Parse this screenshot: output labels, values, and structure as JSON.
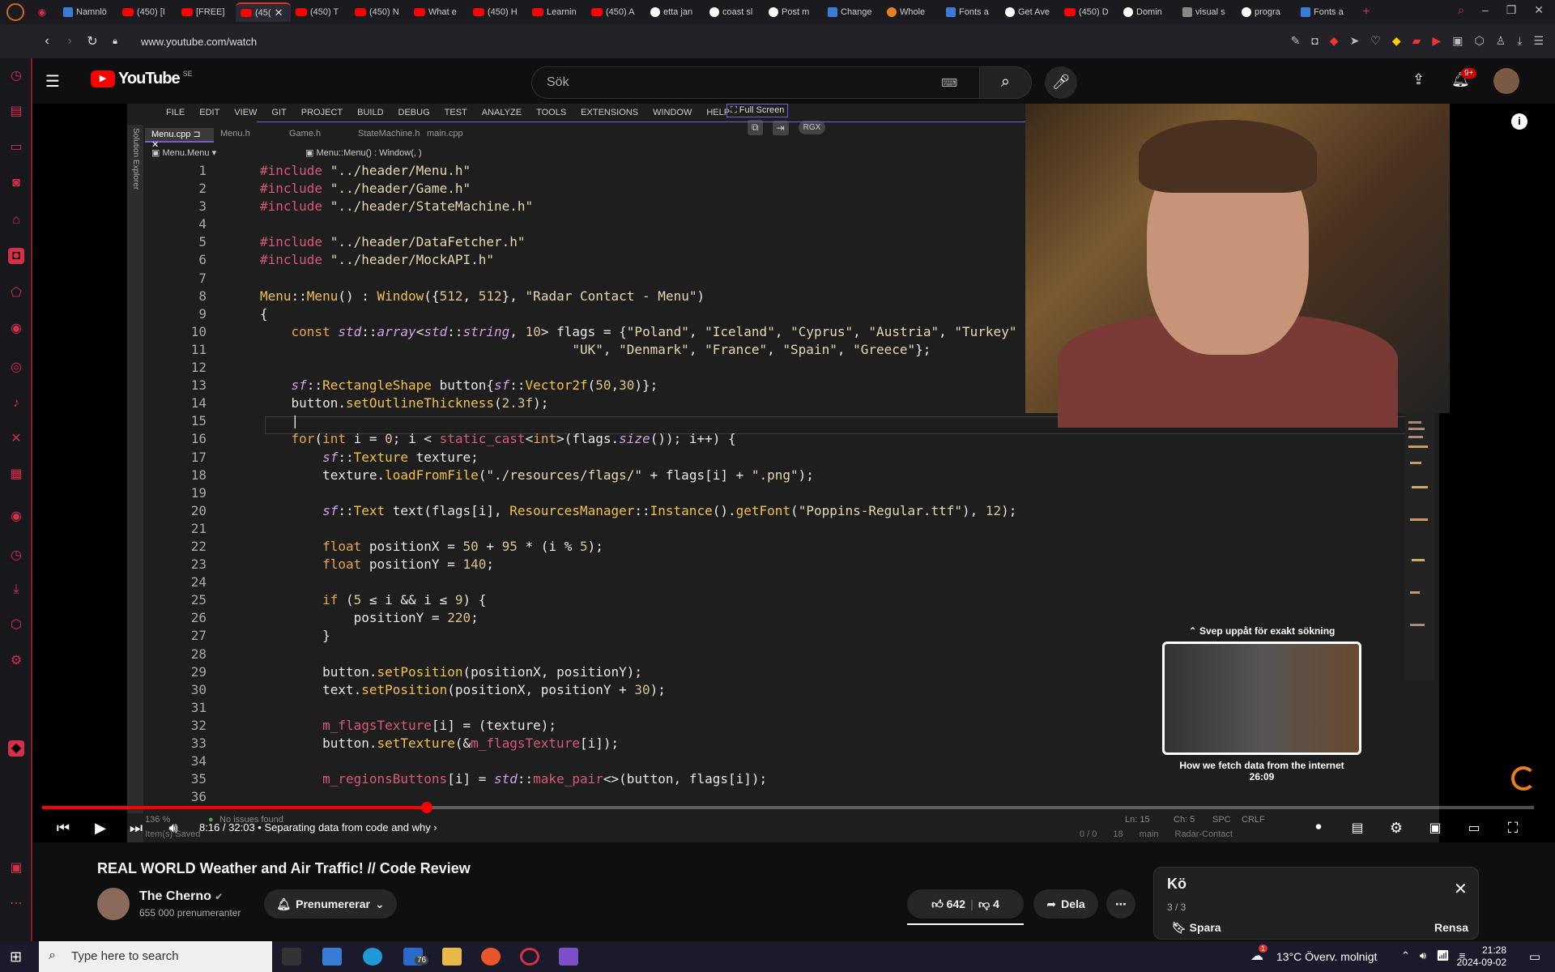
{
  "browser": {
    "tabs": [
      {
        "label": "Namnlö",
        "icon": "docs-icon"
      },
      {
        "label": "(450) [I",
        "icon": "youtube-icon"
      },
      {
        "label": "[FREE]",
        "icon": "youtube-icon"
      },
      {
        "label": "(45(",
        "icon": "youtube-icon",
        "active": true
      },
      {
        "label": "(450) T",
        "icon": "youtube-icon"
      },
      {
        "label": "(450) N",
        "icon": "youtube-icon"
      },
      {
        "label": "What e",
        "icon": "youtube-icon"
      },
      {
        "label": "(450) H",
        "icon": "youtube-icon"
      },
      {
        "label": "Learnin",
        "icon": "youtube-icon"
      },
      {
        "label": "(450) A",
        "icon": "youtube-icon"
      },
      {
        "label": "etta jan",
        "icon": "google-icon"
      },
      {
        "label": "coast sl",
        "icon": "google-icon"
      },
      {
        "label": "Post m",
        "icon": "google-icon"
      },
      {
        "label": "Change",
        "icon": "microsoft-icon"
      },
      {
        "label": "Whole",
        "icon": "fruit-icon"
      },
      {
        "label": "Fonts a",
        "icon": "microsoft-icon"
      },
      {
        "label": "Get Ave",
        "icon": "google-icon"
      },
      {
        "label": "(450) D",
        "icon": "youtube-icon"
      },
      {
        "label": "Domin",
        "icon": "google-icon"
      },
      {
        "label": "visual s",
        "icon": "tool-icon"
      },
      {
        "label": "progra",
        "icon": "google-icon"
      },
      {
        "label": "Fonts a",
        "icon": "microsoft-icon"
      }
    ],
    "url": "www.youtube.com/watch"
  },
  "youtube": {
    "logo": "YouTube",
    "region": "SE",
    "search_placeholder": "Sök",
    "notifications": "9+"
  },
  "ide": {
    "menu": [
      "FILE",
      "EDIT",
      "VIEW",
      "GIT",
      "PROJECT",
      "BUILD",
      "DEBUG",
      "TEST",
      "ANALYZE",
      "TOOLS",
      "EXTENSIONS",
      "WINDOW",
      "HELP"
    ],
    "fullscreen": "Full Screen",
    "rgx": "RGX",
    "doc_tabs": [
      "Menu.cpp",
      "Menu.h",
      "Game.h",
      "StateMachine.h",
      "main.cpp"
    ],
    "solution_explorer": "Solution Explorer",
    "nav_left": "Menu.Menu",
    "nav_right": "Menu::Menu() : Window(, )",
    "status": {
      "zoom": "136 %",
      "issues": "No issues found",
      "ln": "Ln: 15",
      "ch": "Ch: 5",
      "spc": "SPC",
      "crlf": "CRLF",
      "saved": "Item(s) Saved",
      "errors": "0 / 0",
      "changes": "18",
      "branch": "main",
      "repo": "Radar-Contact"
    }
  },
  "code_lines": [
    {
      "n": "1",
      "html": "<span class='pp'>#include</span> <span class='st'>\"../header/Menu.h\"</span>"
    },
    {
      "n": "2",
      "html": "<span class='pp'>#include</span> <span class='st'>\"../header/Game.h\"</span>"
    },
    {
      "n": "3",
      "html": "<span class='pp'>#include</span> <span class='st'>\"../header/StateMachine.h\"</span>"
    },
    {
      "n": "4",
      "html": ""
    },
    {
      "n": "5",
      "html": "<span class='pp'>#include</span> <span class='st'>\"../header/DataFetcher.h\"</span>"
    },
    {
      "n": "6",
      "html": "<span class='pp'>#include</span> <span class='st'>\"../header/MockAPI.h\"</span>"
    },
    {
      "n": "7",
      "html": ""
    },
    {
      "n": "8",
      "html": "<span class='fn'>Menu</span><span class='pl'>::</span><span class='fn'>Menu</span><span class='pl'>() : </span><span class='fn'>Window</span><span class='pl'>({</span><span class='nm'>512</span><span class='pl'>, </span><span class='nm'>512</span><span class='pl'>}, </span><span class='st'>\"Radar Contact - Menu\"</span><span class='pl'>)</span>"
    },
    {
      "n": "9",
      "html": "<span class='pl'>{</span>"
    },
    {
      "n": "10",
      "html": "    <span class='kw'>const</span> <span class='ty'>std</span><span class='pl'>::</span><span class='ty'>array</span><span class='pl'>&lt;</span><span class='ty'>std</span><span class='pl'>::</span><span class='ty'>string</span><span class='pl'>, </span><span class='nm'>10</span><span class='pl'>&gt; flags = {</span><span class='st'>\"Poland\"</span><span class='pl'>, </span><span class='st'>\"Iceland\"</span><span class='pl'>, </span><span class='st'>\"Cyprus\"</span><span class='pl'>, </span><span class='st'>\"Austria\"</span><span class='pl'>, </span><span class='st'>\"Turkey\"</span>"
    },
    {
      "n": "11",
      "html": "                                        <span class='st'>\"UK\"</span><span class='pl'>, </span><span class='st'>\"Denmark\"</span><span class='pl'>, </span><span class='st'>\"France\"</span><span class='pl'>, </span><span class='st'>\"Spain\"</span><span class='pl'>, </span><span class='st'>\"Greece\"</span><span class='pl'>};</span>"
    },
    {
      "n": "12",
      "html": ""
    },
    {
      "n": "13",
      "html": "    <span class='ty'>sf</span><span class='pl'>::</span><span class='fn'>RectangleShape</span> <span class='pl'>button{</span><span class='ty'>sf</span><span class='pl'>::</span><span class='fn'>Vector2f</span><span class='pl'>(</span><span class='nm'>50</span><span class='pl'>,</span><span class='nm'>30</span><span class='pl'>)};</span>"
    },
    {
      "n": "14",
      "html": "    <span class='pl'>button.</span><span class='fn'>setOutlineThickness</span><span class='pl'>(</span><span class='nm'>2.3f</span><span class='pl'>);</span>"
    },
    {
      "n": "15",
      "html": "    <span class='pl'>|</span>"
    },
    {
      "n": "16",
      "html": "    <span class='kw'>for</span><span class='pl'>(</span><span class='kw'>int</span><span class='pl'> i = </span><span class='nm'>0</span><span class='pl'>; i &lt; </span><span class='pp'>static_cast</span><span class='pl'>&lt;</span><span class='kw'>int</span><span class='pl'>&gt;(flags.</span><span class='ty'>size</span><span class='pl'>()); i++) {</span>"
    },
    {
      "n": "17",
      "html": "        <span class='ty'>sf</span><span class='pl'>::</span><span class='fn'>Texture</span><span class='pl'> texture;</span>"
    },
    {
      "n": "18",
      "html": "        <span class='pl'>texture.</span><span class='fn'>loadFromFile</span><span class='pl'>(</span><span class='st'>\"./resources/flags/\"</span><span class='pl'> + flags[i] + </span><span class='st'>\".png\"</span><span class='pl'>);</span>"
    },
    {
      "n": "19",
      "html": ""
    },
    {
      "n": "20",
      "html": "        <span class='ty'>sf</span><span class='pl'>::</span><span class='fn'>Text</span><span class='pl'> text(flags[i], </span><span class='fn'>ResourcesManager</span><span class='pl'>::</span><span class='fn'>Instance</span><span class='pl'>().</span><span class='fn'>getFont</span><span class='pl'>(</span><span class='st'>\"Poppins-Regular.ttf\"</span><span class='pl'>), </span><span class='nm'>12</span><span class='pl'>);</span>"
    },
    {
      "n": "21",
      "html": ""
    },
    {
      "n": "22",
      "html": "        <span class='kw'>float</span><span class='pl'> positionX = </span><span class='nm'>50</span><span class='pl'> + </span><span class='nm'>95</span><span class='pl'> * (i % </span><span class='nm'>5</span><span class='pl'>);</span>"
    },
    {
      "n": "23",
      "html": "        <span class='kw'>float</span><span class='pl'> positionY = </span><span class='nm'>140</span><span class='pl'>;</span>"
    },
    {
      "n": "24",
      "html": ""
    },
    {
      "n": "25",
      "html": "        <span class='kw'>if</span><span class='pl'> (</span><span class='nm'>5</span><span class='pl'> ≤ i &amp;&amp; i ≤ </span><span class='nm'>9</span><span class='pl'>) {</span>"
    },
    {
      "n": "26",
      "html": "            <span class='pl'>positionY = </span><span class='nm'>220</span><span class='pl'>;</span>"
    },
    {
      "n": "27",
      "html": "        <span class='pl'>}</span>"
    },
    {
      "n": "28",
      "html": ""
    },
    {
      "n": "29",
      "html": "        <span class='pl'>button.</span><span class='fn'>setPosition</span><span class='pl'>(positionX, positionY);</span>"
    },
    {
      "n": "30",
      "html": "        <span class='pl'>text.</span><span class='fn'>setPosition</span><span class='pl'>(positionX, positionY + </span><span class='nm'>30</span><span class='pl'>);</span>"
    },
    {
      "n": "31",
      "html": ""
    },
    {
      "n": "32",
      "html": "        <span class='pp'>m_flagsTexture</span><span class='pl'>[i] = (texture);</span>"
    },
    {
      "n": "33",
      "html": "        <span class='pl'>button.</span><span class='fn'>setTexture</span><span class='pl'>(&amp;</span><span class='pp'>m_flagsTexture</span><span class='pl'>[i]);</span>"
    },
    {
      "n": "34",
      "html": ""
    },
    {
      "n": "35",
      "html": "        <span class='pp'>m_regionsButtons</span><span class='pl'>[i] = </span><span class='ty'>std</span><span class='pl'>::</span><span class='pp'>make_pair</span><span class='pl'>&lt;&gt;(button, flags[i]);</span>"
    },
    {
      "n": "36",
      "html": ""
    }
  ],
  "player": {
    "time": "8:16 / 32:03",
    "chapter": "Separating data from code and why",
    "progress": 0.258,
    "endcard_hint": "Svep uppåt för exakt sökning",
    "endcard_title": "How we fetch data from the internet",
    "endcard_duration": "26:09"
  },
  "video": {
    "title": "REAL WORLD Weather and Air Traffic! // Code Review",
    "channel": "The Cherno",
    "subscribers": "655 000 prenumeranter",
    "subscribe_label": "Prenumererar",
    "likes": "642",
    "dislikes": "4",
    "share": "Dela"
  },
  "queue": {
    "title": "Kö",
    "count": "3 / 3",
    "save": "Spara",
    "clear": "Rensa"
  },
  "taskbar": {
    "search": "Type here to search",
    "mail_badge": "76",
    "weather": "13°C  Överv. molnigt",
    "weather_badge": "1",
    "time": "21:28",
    "date": "2024-09-02"
  }
}
